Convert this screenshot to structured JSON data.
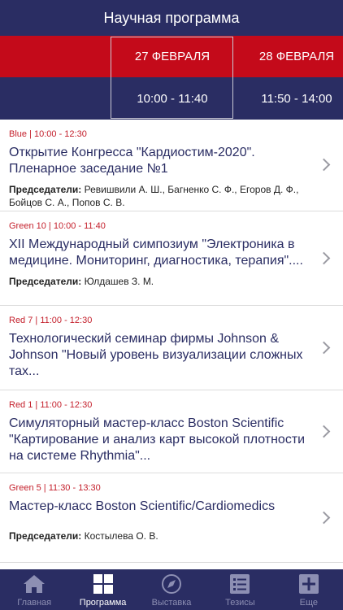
{
  "header": {
    "title": "Научная программа"
  },
  "dates": [
    {
      "label": "27 ФЕВРАЛЯ",
      "selected": true
    },
    {
      "label": "28 ФЕВРАЛЯ",
      "selected": false
    }
  ],
  "times": [
    {
      "label": "10:00 - 11:40",
      "selected": true
    },
    {
      "label": "11:50 - 14:00",
      "selected": false
    }
  ],
  "sessions": [
    {
      "meta": "Blue | 10:00 - 12:30",
      "title": "Открытие Конгресса \"Кардиостим-2020\". Пленарное заседание №1",
      "chairs_label": "Председатели:",
      "chairs": "Ревишвили А. Ш., Багненко С. Ф., Егоров Д. Ф., Бойцов С. А., Попов С. В."
    },
    {
      "meta": "Green 10 | 10:00 - 11:40",
      "title": "XII Международный симпозиум \"Электроника в медицине. Мониторинг, диагностика, терапия\"....",
      "chairs_label": "Председатели:",
      "chairs": "Юлдашев З. М."
    },
    {
      "meta": "Red 7 | 11:00 - 12:30",
      "title": "Технологический семинар фирмы Johnson & Johnson \"Новый уровень визуализации сложных тах..."
    },
    {
      "meta": "Red 1 | 11:00 - 12:30",
      "title": "Симуляторный мастер-класс Boston Scientific \"Картирование и анализ карт высокой плотности на системе Rhythmia\"..."
    },
    {
      "meta": "Green 5 | 11:30 - 13:30",
      "title": "Мастер-класс Boston Scientific/Cardiomedics",
      "chairs_label": "Председатели:",
      "chairs": "Костылева О. В."
    }
  ],
  "tabbar": [
    {
      "label": "Главная",
      "icon": "home-icon"
    },
    {
      "label": "Программа",
      "icon": "grid-icon",
      "active": true
    },
    {
      "label": "Выставка",
      "icon": "compass-icon"
    },
    {
      "label": "Тезисы",
      "icon": "list-icon"
    },
    {
      "label": "Еще",
      "icon": "plus-icon"
    }
  ],
  "colors": {
    "navy": "#2a2d63",
    "red": "#c40a1a",
    "meta": "#c4202c"
  }
}
